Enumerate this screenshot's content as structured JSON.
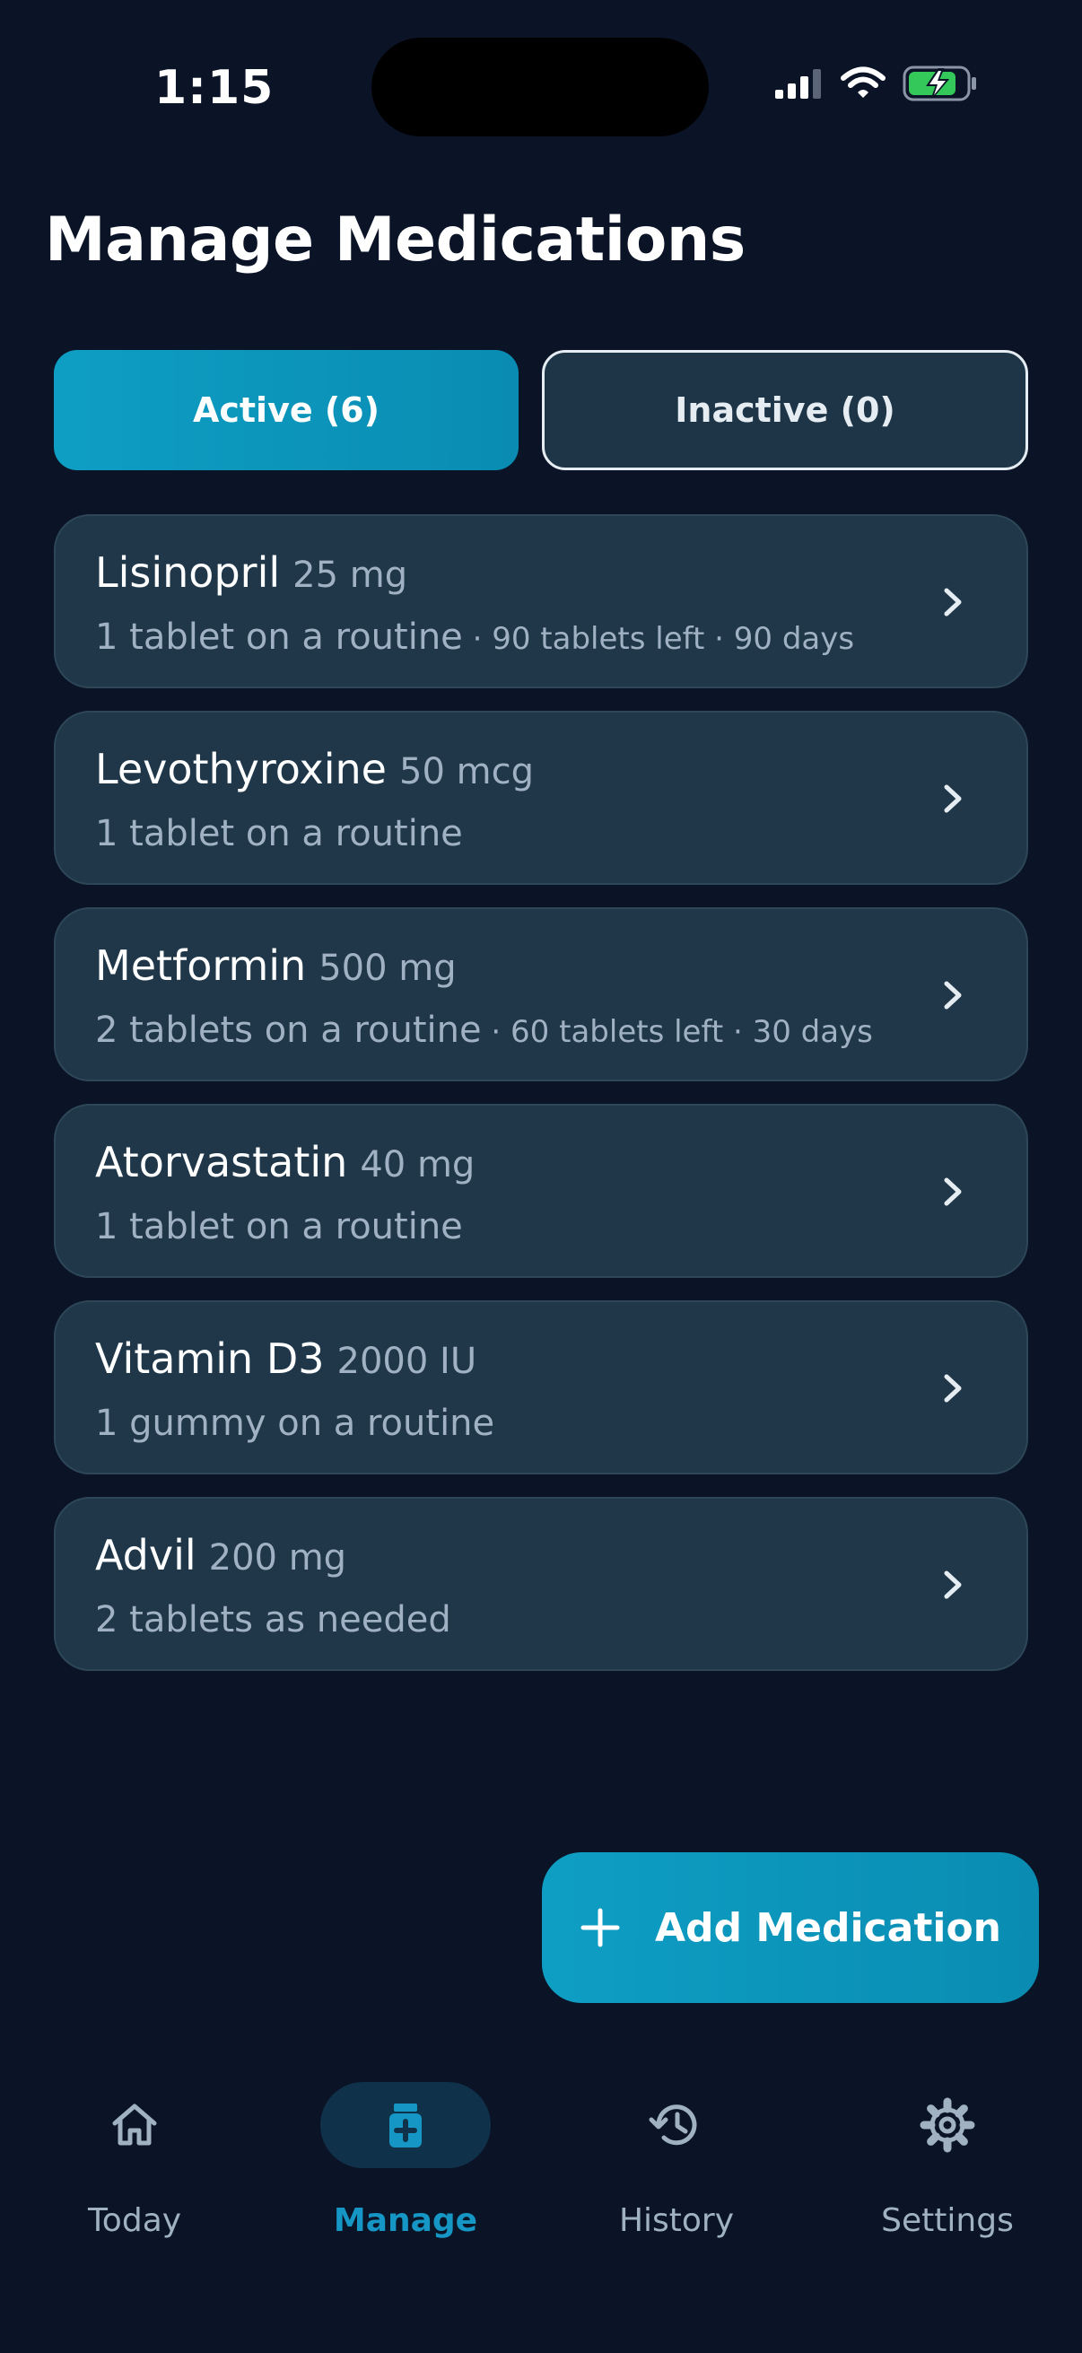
{
  "status_bar": {
    "time": "1:15"
  },
  "header": {
    "title": "Manage Medications"
  },
  "tabs": [
    {
      "label": "Active (6)",
      "selected": true
    },
    {
      "label": "Inactive (0)",
      "selected": false
    }
  ],
  "medications": [
    {
      "name": "Lisinopril",
      "dose": "25 mg",
      "schedule": "1 tablet on a routine",
      "extra": " · 90 tablets left · 90 days"
    },
    {
      "name": "Levothyroxine",
      "dose": "50 mcg",
      "schedule": "1 tablet on a routine",
      "extra": ""
    },
    {
      "name": "Metformin",
      "dose": "500 mg",
      "schedule": "2 tablets on a routine",
      "extra": " · 60 tablets left · 30 days"
    },
    {
      "name": "Atorvastatin",
      "dose": "40 mg",
      "schedule": "1 tablet on a routine",
      "extra": ""
    },
    {
      "name": "Vitamin D3",
      "dose": "2000 IU",
      "schedule": "1 gummy on a routine",
      "extra": ""
    },
    {
      "name": "Advil",
      "dose": "200 mg",
      "schedule": "2 tablets as needed",
      "extra": ""
    }
  ],
  "fab": {
    "label": "Add Medication",
    "icon": "plus-icon"
  },
  "bottom_nav": [
    {
      "label": "Today",
      "icon": "home-icon",
      "active": false
    },
    {
      "label": "Manage",
      "icon": "medicine-bottle-icon",
      "active": true
    },
    {
      "label": "History",
      "icon": "history-icon",
      "active": false
    },
    {
      "label": "Settings",
      "icon": "gear-icon",
      "active": false
    }
  ],
  "colors": {
    "background": "#0b1426",
    "card": "#1f3749",
    "accent": "#0e9ec4",
    "muted_text": "#9fb1c2",
    "battery_green": "#34c759"
  }
}
